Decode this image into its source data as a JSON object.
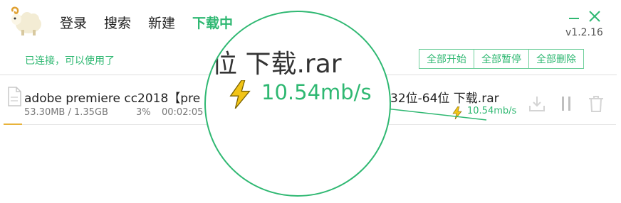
{
  "app": {
    "version": "v1.2.16"
  },
  "nav": {
    "items": [
      {
        "label": "登录",
        "active": false
      },
      {
        "label": "搜索",
        "active": false
      },
      {
        "label": "新建",
        "active": false
      },
      {
        "label": "下载中",
        "active": true
      }
    ]
  },
  "status": {
    "text": "已连接，可以使用了"
  },
  "toolbar": {
    "start_all": "全部开始",
    "pause_all": "全部暂停",
    "delete_all": "全部删除"
  },
  "download": {
    "name_left": "adobe premiere cc2018【pre",
    "name_right": "32位-64位 下载.rar",
    "size": "53.30MB / 1.35GB",
    "percent": "3%",
    "progress": 0.03,
    "time": "00:02:05",
    "speed": "10.54mb/s"
  },
  "magnifier": {
    "name": "位 下载.rar",
    "speed": "10.54mb/s"
  },
  "colors": {
    "accent": "#2fb872",
    "progress": "#e8b33a"
  },
  "icons": [
    "sheep-logo-icon",
    "minimize-icon",
    "close-icon",
    "file-icon",
    "lightning-icon",
    "download-icon",
    "pause-icon",
    "trash-icon"
  ]
}
